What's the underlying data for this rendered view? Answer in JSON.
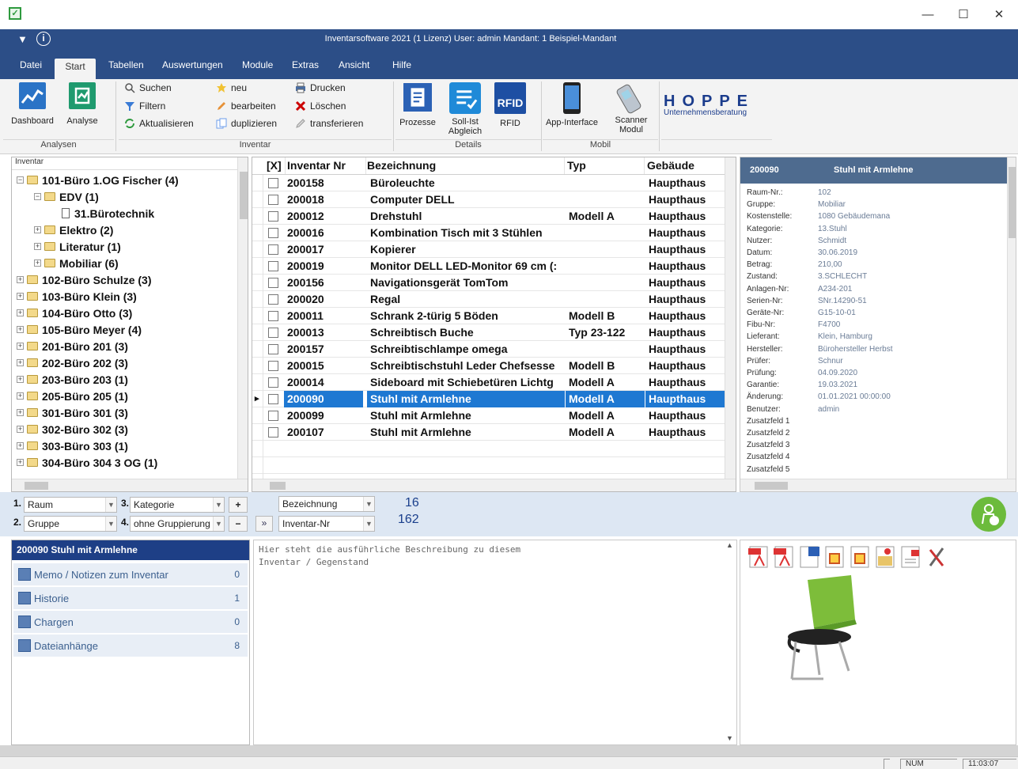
{
  "window": {
    "title": "Inventarsoftware 2021 (1 Lizenz)  User: admin   Mandant: 1 Beispiel-Mandant",
    "minimize": "—",
    "maximize": "☐",
    "close": "✕"
  },
  "tabs": [
    "Datei",
    "Start",
    "Tabellen",
    "Auswertungen",
    "Module",
    "Extras",
    "Ansicht",
    "Hilfe"
  ],
  "ribbon": {
    "analysen": {
      "label": "Analysen",
      "dashboard": "Dashboard",
      "analyse": "Analyse"
    },
    "inventar": {
      "label": "Inventar",
      "suchen": "Suchen",
      "filtern": "Filtern",
      "aktualisieren": "Aktualisieren",
      "neu": "neu",
      "bearbeiten": "bearbeiten",
      "duplizieren": "duplizieren",
      "drucken": "Drucken",
      "loeschen": "Löschen",
      "transferieren": "transferieren"
    },
    "details": {
      "label": "Details",
      "prozesse": "Prozesse",
      "soll_ist": "Soll-Ist\nAbgleich",
      "rfid": "RFID",
      "rfid_icon": "RFID"
    },
    "mobil": {
      "label": "Mobil",
      "app_interface": "App-Interface",
      "scanner": "Scanner\nModul"
    },
    "hoppe": {
      "logo": "HOPPE",
      "sub": "Unternehmensberatung"
    }
  },
  "tree": {
    "header": "Inventar",
    "nodes": [
      {
        "label": "101-Büro 1.OG Fischer (4)",
        "level": 0,
        "exp": "−",
        "type": "folder-open"
      },
      {
        "label": "EDV (1)",
        "level": 1,
        "exp": "−",
        "type": "folder-open"
      },
      {
        "label": "31.Bürotechnik",
        "level": 2,
        "exp": "",
        "type": "doc"
      },
      {
        "label": "Elektro (2)",
        "level": 1,
        "exp": "+",
        "type": "folder"
      },
      {
        "label": "Literatur (1)",
        "level": 1,
        "exp": "+",
        "type": "folder"
      },
      {
        "label": "Mobiliar (6)",
        "level": 1,
        "exp": "+",
        "type": "folder"
      },
      {
        "label": "102-Büro Schulze (3)",
        "level": 0,
        "exp": "+",
        "type": "folder"
      },
      {
        "label": "103-Büro Klein (3)",
        "level": 0,
        "exp": "+",
        "type": "folder"
      },
      {
        "label": "104-Büro Otto (3)",
        "level": 0,
        "exp": "+",
        "type": "folder"
      },
      {
        "label": "105-Büro Meyer (4)",
        "level": 0,
        "exp": "+",
        "type": "folder"
      },
      {
        "label": "201-Büro 201 (3)",
        "level": 0,
        "exp": "+",
        "type": "folder"
      },
      {
        "label": "202-Büro 202 (3)",
        "level": 0,
        "exp": "+",
        "type": "folder"
      },
      {
        "label": "203-Büro 203 (1)",
        "level": 0,
        "exp": "+",
        "type": "folder"
      },
      {
        "label": "205-Büro 205 (1)",
        "level": 0,
        "exp": "+",
        "type": "folder"
      },
      {
        "label": "301-Büro 301 (3)",
        "level": 0,
        "exp": "+",
        "type": "folder"
      },
      {
        "label": "302-Büro 302 (3)",
        "level": 0,
        "exp": "+",
        "type": "folder"
      },
      {
        "label": "303-Büro 303 (1)",
        "level": 0,
        "exp": "+",
        "type": "folder"
      },
      {
        "label": "304-Büro 304 3 OG (1)",
        "level": 0,
        "exp": "+",
        "type": "folder"
      }
    ]
  },
  "grid": {
    "headers": [
      "[X]",
      "Inventar Nr",
      "Bezeichnung",
      "Typ",
      "Gebäude"
    ],
    "rows": [
      {
        "nr": "200158",
        "bez": "Büroleuchte",
        "typ": "",
        "geb": "Haupthaus"
      },
      {
        "nr": "200018",
        "bez": "Computer DELL",
        "typ": "",
        "geb": "Haupthaus"
      },
      {
        "nr": "200012",
        "bez": "Drehstuhl",
        "typ": "Modell A",
        "geb": "Haupthaus"
      },
      {
        "nr": "200016",
        "bez": "Kombination Tisch mit 3 Stühlen",
        "typ": "",
        "geb": "Haupthaus"
      },
      {
        "nr": "200017",
        "bez": "Kopierer",
        "typ": "",
        "geb": "Haupthaus"
      },
      {
        "nr": "200019",
        "bez": "Monitor DELL LED-Monitor 69 cm (:",
        "typ": "",
        "geb": "Haupthaus"
      },
      {
        "nr": "200156",
        "bez": "Navigationsgerät TomTom",
        "typ": "",
        "geb": "Haupthaus"
      },
      {
        "nr": "200020",
        "bez": "Regal",
        "typ": "",
        "geb": "Haupthaus"
      },
      {
        "nr": "200011",
        "bez": "Schrank 2-türig 5 Böden",
        "typ": "Modell B",
        "geb": "Haupthaus"
      },
      {
        "nr": "200013",
        "bez": "Schreibtisch Buche",
        "typ": "Typ 23-122",
        "geb": "Haupthaus"
      },
      {
        "nr": "200157",
        "bez": "Schreibtischlampe omega",
        "typ": "",
        "geb": "Haupthaus"
      },
      {
        "nr": "200015",
        "bez": "Schreibtischstuhl Leder Chefsesse",
        "typ": "Modell B",
        "geb": "Haupthaus"
      },
      {
        "nr": "200014",
        "bez": "Sideboard mit Schiebetüren Lichtg",
        "typ": "Modell A",
        "geb": "Haupthaus"
      },
      {
        "nr": "200090",
        "bez": "Stuhl mit Armlehne",
        "typ": "Modell A",
        "geb": "Haupthaus",
        "selected": true
      },
      {
        "nr": "200099",
        "bez": "Stuhl mit Armlehne",
        "typ": "Modell A",
        "geb": "Haupthaus"
      },
      {
        "nr": "200107",
        "bez": "Stuhl mit Armlehne",
        "typ": "Modell A",
        "geb": "Haupthaus"
      }
    ]
  },
  "detail": {
    "nr": "200090",
    "title": "Stuhl mit Armlehne",
    "fields": [
      {
        "label": "Raum-Nr.:",
        "value": "102"
      },
      {
        "label": "Gruppe:",
        "value": "Mobiliar"
      },
      {
        "label": "Kostenstelle:",
        "value": "1080 Gebäudemana"
      },
      {
        "label": "Kategorie:",
        "value": "13.Stuhl"
      },
      {
        "label": "Nutzer:",
        "value": "Schmidt"
      },
      {
        "label": "Datum:",
        "value": "30.06.2019"
      },
      {
        "label": "Betrag:",
        "value": "210,00"
      },
      {
        "label": "Zustand:",
        "value": "3.SCHLECHT"
      },
      {
        "label": "Anlagen-Nr:",
        "value": "A234-201"
      },
      {
        "label": "Serien-Nr:",
        "value": "SNr.14290-51"
      },
      {
        "label": "Geräte-Nr:",
        "value": "G15-10-01"
      },
      {
        "label": "Fibu-Nr:",
        "value": "F4700"
      },
      {
        "label": "Lieferant:",
        "value": "Klein, Hamburg"
      },
      {
        "label": "Hersteller:",
        "value": "Bürohersteller Herbst"
      },
      {
        "label": "Prüfer:",
        "value": "Schnur"
      },
      {
        "label": "Prüfung:",
        "value": "04.09.2020"
      },
      {
        "label": "Garantie:",
        "value": "19.03.2021"
      },
      {
        "label": "Änderung:",
        "value": "01.01.2021 00:00:00"
      },
      {
        "label": "Benutzer:",
        "value": "admin"
      },
      {
        "label": "Zusatzfeld 1",
        "value": ""
      },
      {
        "label": "Zusatzfeld 2",
        "value": ""
      },
      {
        "label": "Zusatzfeld 3",
        "value": ""
      },
      {
        "label": "Zusatzfeld 4",
        "value": ""
      },
      {
        "label": "Zusatzfeld 5",
        "value": ""
      }
    ]
  },
  "filters": {
    "f1_num": "1.",
    "f1": "Raum",
    "f2_num": "2.",
    "f2": "Gruppe",
    "f3_num": "3.",
    "f3": "Kategorie",
    "f4_num": "4.",
    "f4": "ohne Gruppierung",
    "sort1": "Bezeichnung",
    "sort2": "Inventar-Nr",
    "count1": "16",
    "count2": "162",
    "plus": "+",
    "minus": "−",
    "toggle": "»"
  },
  "leftpanel": {
    "title": "200090 Stuhl mit Armlehne",
    "items": [
      {
        "label": "Memo / Notizen zum Inventar",
        "count": "0"
      },
      {
        "label": "Historie",
        "count": "1"
      },
      {
        "label": "Chargen",
        "count": "0"
      },
      {
        "label": "Dateianhänge",
        "count": "8"
      }
    ]
  },
  "description": "Hier steht die ausführliche Beschreibung zu diesem\nInventar / Gegenstand",
  "status": {
    "num": "NUM",
    "time": "11:03:07"
  },
  "colors": {
    "bluebar": "#2c4e87",
    "selection": "#1e78d2",
    "filterbar": "#dde7f3"
  }
}
